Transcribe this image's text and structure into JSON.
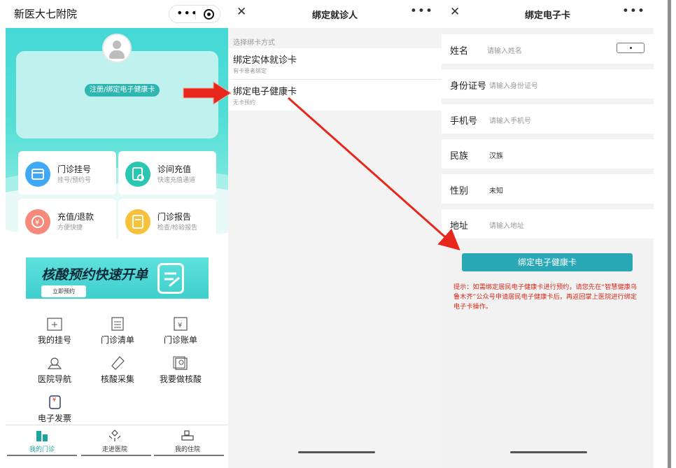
{
  "home": {
    "title": "新医大七附院",
    "register_label": "注册/绑定电子健康卡",
    "grid": [
      {
        "title": "门诊挂号",
        "subtitle": "挂号/预约号",
        "color": "#3fa9f5"
      },
      {
        "title": "诊间充值",
        "subtitle": "快速充值通道",
        "color": "#29c7b1"
      },
      {
        "title": "充值/退款",
        "subtitle": "方便快捷",
        "color": "#f6897a"
      },
      {
        "title": "门诊报告",
        "subtitle": "检查/检验报告",
        "color": "#f7c23a"
      }
    ],
    "banner": {
      "title": "核酸预约快速开单",
      "button": "立即预约"
    },
    "menu": [
      "我的挂号",
      "门诊清单",
      "门诊账单",
      "医院导航",
      "核酸采集",
      "我要做核酸",
      "电子发票"
    ],
    "tabs": [
      "我的门诊",
      "走进医院",
      "我的住院"
    ],
    "accent": "#1aa59f"
  },
  "bind_patient": {
    "title": "绑定就诊人",
    "section_label": "选择绑卡方式",
    "options": [
      {
        "title": "绑定实体就诊卡",
        "subtitle": "有卡患者绑定"
      },
      {
        "title": "绑定电子健康卡",
        "subtitle": "无卡预约"
      }
    ]
  },
  "bind_card": {
    "title": "绑定电子卡",
    "fields": [
      {
        "label": "姓名",
        "value": "请输入姓名"
      },
      {
        "label": "身份证号",
        "value": "请输入身份证号"
      },
      {
        "label": "手机号",
        "value": "请输入手机号"
      },
      {
        "label": "民族",
        "value": "汉族"
      },
      {
        "label": "性别",
        "value": "未知"
      },
      {
        "label": "地址",
        "value": "请输入地址"
      }
    ],
    "button": "绑定电子健康卡",
    "tip": "提示：如需绑定居民电子健康卡进行预约，请您先在“智慧健康乌鲁木齐”公众号申请居民电子健康卡后，再返回掌上医院进行绑定电子卡操作。",
    "accent": "#2aa8b5",
    "tip_color": "#d9281a"
  },
  "annotation_color": "#e8271c"
}
